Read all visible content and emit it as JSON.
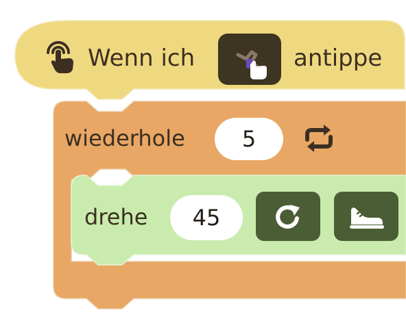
{
  "event_block": {
    "label_before": "Wenn ich",
    "label_after": "antippe",
    "icon": "tap-hand-icon",
    "sprite": "sprite-thumbnail",
    "color": "#efd980"
  },
  "repeat_block": {
    "label": "wiederhole",
    "value": "5",
    "icon": "repeat-icon",
    "color": "#e8a765"
  },
  "turn_block": {
    "label": "drehe",
    "value": "45",
    "rotate_icon": "rotate-clockwise-icon",
    "sprite_icon": "shoe-icon",
    "color": "#c9ecae"
  },
  "colors": {
    "dark_button": "#4b5d35",
    "text": "#3c2f22"
  }
}
